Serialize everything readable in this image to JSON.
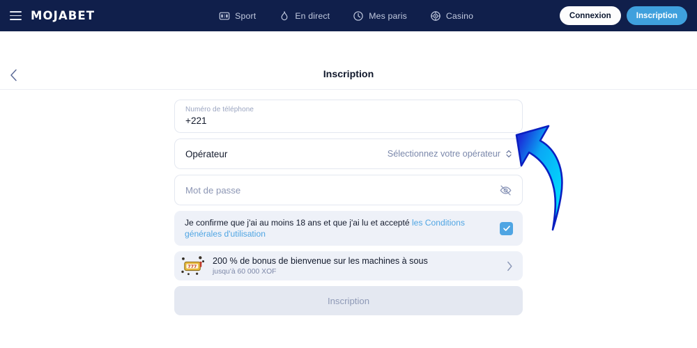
{
  "header": {
    "brand": "MOJABET",
    "menu_icon": "hamburger-icon",
    "nav": [
      {
        "label": "Sport",
        "icon": "scoreboard-icon",
        "icon_text": "2:1"
      },
      {
        "label": "En direct",
        "icon": "flame-icon"
      },
      {
        "label": "Mes paris",
        "icon": "clock-icon"
      },
      {
        "label": "Casino",
        "icon": "casino-chip-icon"
      }
    ],
    "login_label": "Connexion",
    "signup_label": "Inscription"
  },
  "titlebar": {
    "back_icon": "chevron-left-icon",
    "title": "Inscription"
  },
  "form": {
    "phone": {
      "label": "Numéro de téléphone",
      "value": "+221"
    },
    "operator": {
      "label": "Opérateur",
      "placeholder": "Sélectionnez votre opérateur",
      "chevron_icon": "chevron-updown-icon"
    },
    "password": {
      "placeholder": "Mot de passe",
      "toggle_icon": "eye-off-icon"
    },
    "consent": {
      "text_before": "Je confirme que j'ai au moins 18 ans et que j'ai lu et accepté ",
      "link_text": "les Conditions générales d'utilisation",
      "checked": true,
      "check_icon": "checkmark-icon"
    },
    "bonus": {
      "icon": "slot-machine-icon",
      "title": "200 % de bonus de bienvenue sur les machines à sous",
      "subtitle": "jusqu'à 60 000 XOF",
      "chevron_icon": "chevron-right-icon"
    },
    "submit_label": "Inscription"
  },
  "annotation": {
    "arrow_icon": "curved-arrow-up-left-icon"
  },
  "colors": {
    "header_bg": "#101f4b",
    "accent_blue": "#4fa5e3",
    "signup_blue": "#3fa0dd",
    "field_grey": "#eef1f8",
    "submit_grey": "#e4e8f1",
    "text_dark": "#141b2d"
  }
}
